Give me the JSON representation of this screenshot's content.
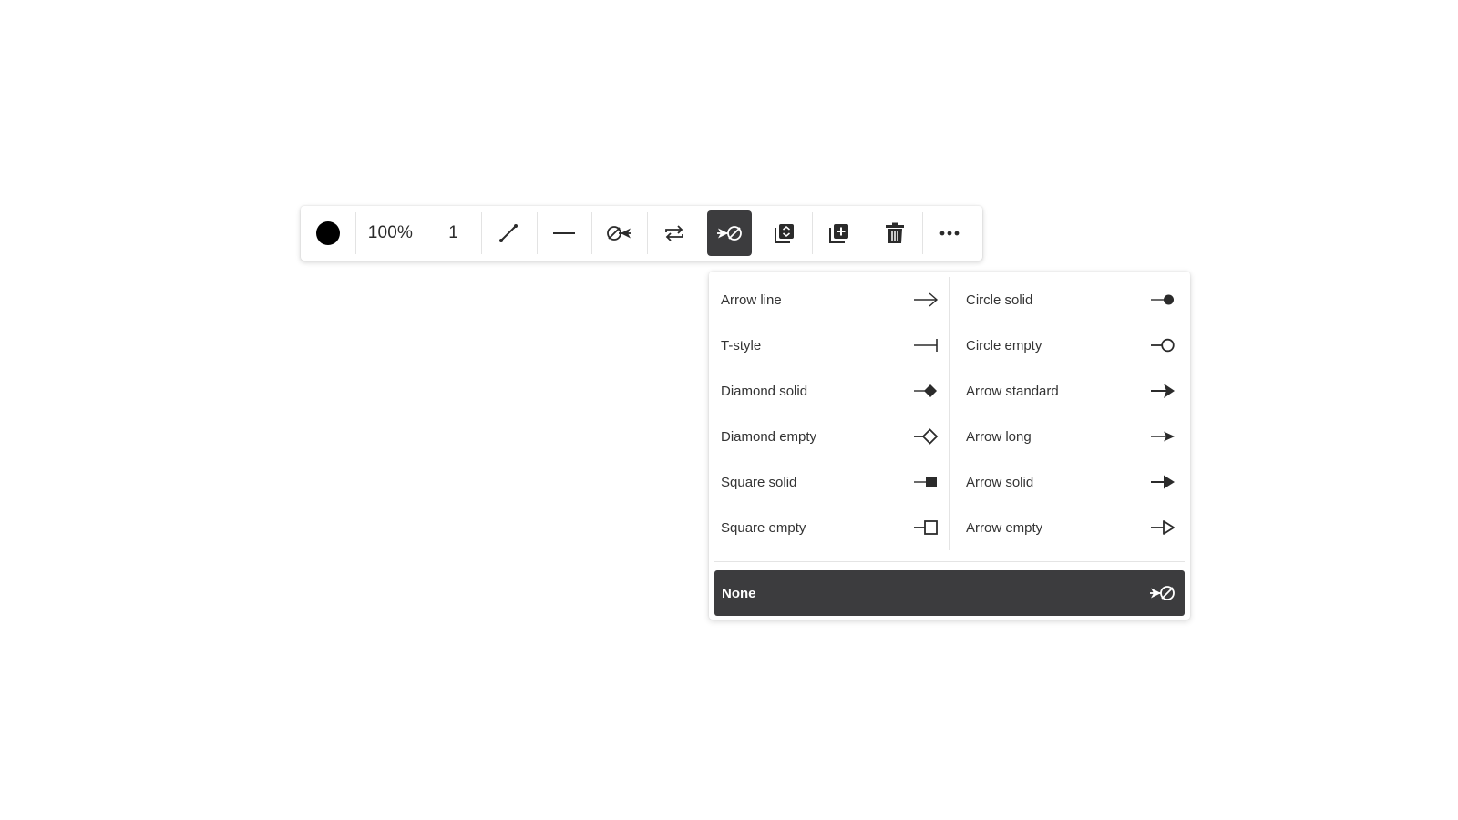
{
  "toolbar": {
    "color_icon": "color-circle",
    "color_value": "#000000",
    "opacity": "100%",
    "stroke_width": "1",
    "buttons": [
      {
        "name": "line-type-diagonal",
        "icon": "diagonal-line-icon"
      },
      {
        "name": "line-style-solid",
        "icon": "solid-line-icon"
      },
      {
        "name": "start-marker",
        "icon": "start-marker-icon"
      },
      {
        "name": "swap-direction",
        "icon": "swap-arrows-icon"
      },
      {
        "name": "end-marker",
        "icon": "end-marker-none-icon",
        "active": true
      },
      {
        "name": "arrange-layers",
        "icon": "layers-icon"
      },
      {
        "name": "duplicate",
        "icon": "duplicate-plus-icon"
      },
      {
        "name": "delete",
        "icon": "trash-icon"
      },
      {
        "name": "more-options",
        "icon": "more-horizontal-icon"
      }
    ],
    "active_color": "#3c3c3e"
  },
  "dropdown": {
    "left_items": [
      {
        "label": "Arrow line",
        "icon": "arrow-line-icon"
      },
      {
        "label": "T-style",
        "icon": "t-style-icon"
      },
      {
        "label": "Diamond solid",
        "icon": "diamond-solid-icon"
      },
      {
        "label": "Diamond empty",
        "icon": "diamond-empty-icon"
      },
      {
        "label": "Square solid",
        "icon": "square-solid-icon"
      },
      {
        "label": "Square empty",
        "icon": "square-empty-icon"
      }
    ],
    "right_items": [
      {
        "label": "Circle solid",
        "icon": "circle-solid-icon"
      },
      {
        "label": "Circle empty",
        "icon": "circle-empty-icon"
      },
      {
        "label": "Arrow standard",
        "icon": "arrow-standard-icon"
      },
      {
        "label": "Arrow long",
        "icon": "arrow-long-icon"
      },
      {
        "label": "Arrow solid",
        "icon": "arrow-solid-icon"
      },
      {
        "label": "Arrow empty",
        "icon": "arrow-empty-icon"
      }
    ],
    "selected": {
      "label": "None",
      "icon": "none-marker-icon"
    }
  }
}
